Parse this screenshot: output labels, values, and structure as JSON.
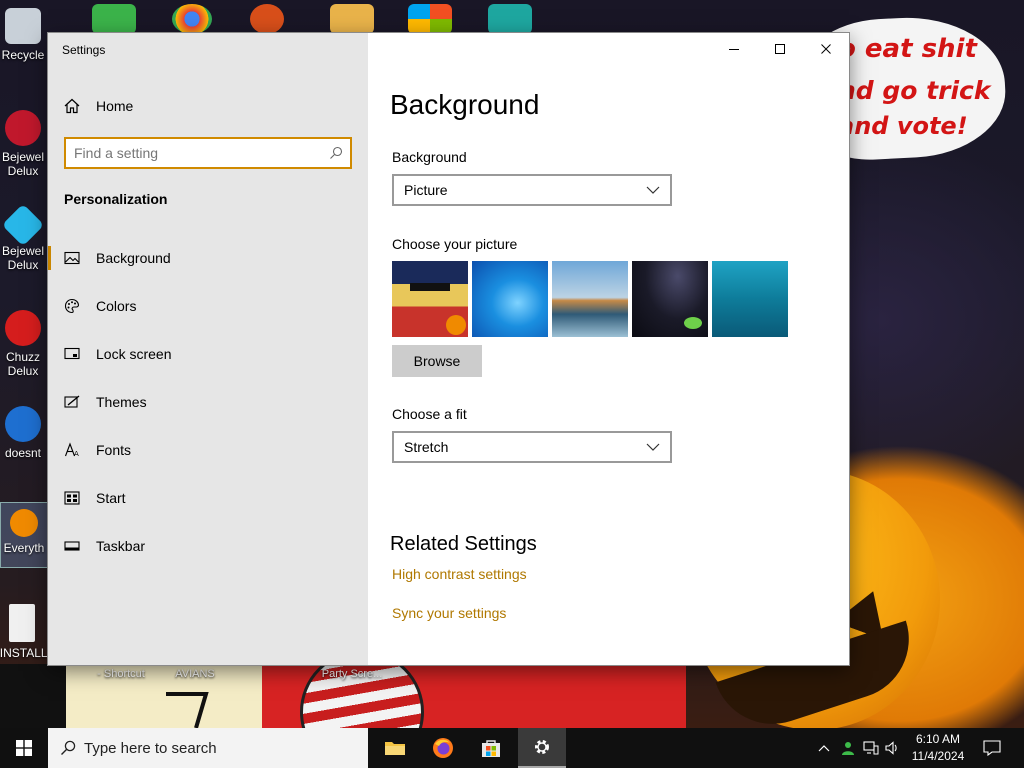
{
  "desktop": {
    "wallpaper_text": [
      "o eat shit",
      "nd go trick",
      "and vote!"
    ],
    "icons_left": [
      {
        "label": "Recycle",
        "name": "recycle-bin"
      },
      {
        "label": "Bejewel Delux",
        "name": "bejeweled-1"
      },
      {
        "label": "Bejewel Delux",
        "name": "bejeweled-2"
      },
      {
        "label": "Chuzz Delux",
        "name": "chuzzle"
      },
      {
        "label": "doesnt",
        "name": "doesnt"
      },
      {
        "label": "Everyth",
        "name": "everything"
      },
      {
        "label": "!INSTALL",
        "name": "install"
      }
    ],
    "bottom_labels": [
      "- Shortcut",
      "AVIANS",
      "Party Scre..."
    ]
  },
  "window": {
    "title": "Settings",
    "controls": {
      "minimize": "minimize",
      "maximize": "maximize",
      "close": "close"
    }
  },
  "sidebar": {
    "home": "Home",
    "search_placeholder": "Find a setting",
    "section": "Personalization",
    "items": [
      {
        "label": "Background",
        "icon": "picture-icon",
        "selected": true
      },
      {
        "label": "Colors",
        "icon": "palette-icon",
        "selected": false
      },
      {
        "label": "Lock screen",
        "icon": "lock-screen-icon",
        "selected": false
      },
      {
        "label": "Themes",
        "icon": "brush-icon",
        "selected": false
      },
      {
        "label": "Fonts",
        "icon": "font-icon",
        "selected": false
      },
      {
        "label": "Start",
        "icon": "start-icon",
        "selected": false
      },
      {
        "label": "Taskbar",
        "icon": "taskbar-icon",
        "selected": false
      }
    ]
  },
  "main": {
    "title": "Background",
    "background_label": "Background",
    "background_value": "Picture",
    "choose_picture_label": "Choose your picture",
    "browse_label": "Browse",
    "fit_label": "Choose a fit",
    "fit_value": "Stretch",
    "related_title": "Related Settings",
    "links": [
      "High contrast settings",
      "Sync your settings"
    ]
  },
  "taskbar": {
    "search_placeholder": "Type here to search",
    "apps": [
      "file-explorer",
      "firefox",
      "microsoft-store",
      "settings"
    ],
    "time": "6:10 AM",
    "date": "11/4/2024"
  },
  "colors": {
    "accent": "#c98600",
    "link": "#b07800",
    "sidebar_bg": "#e6e6e6",
    "taskbar_bg": "#101010"
  }
}
